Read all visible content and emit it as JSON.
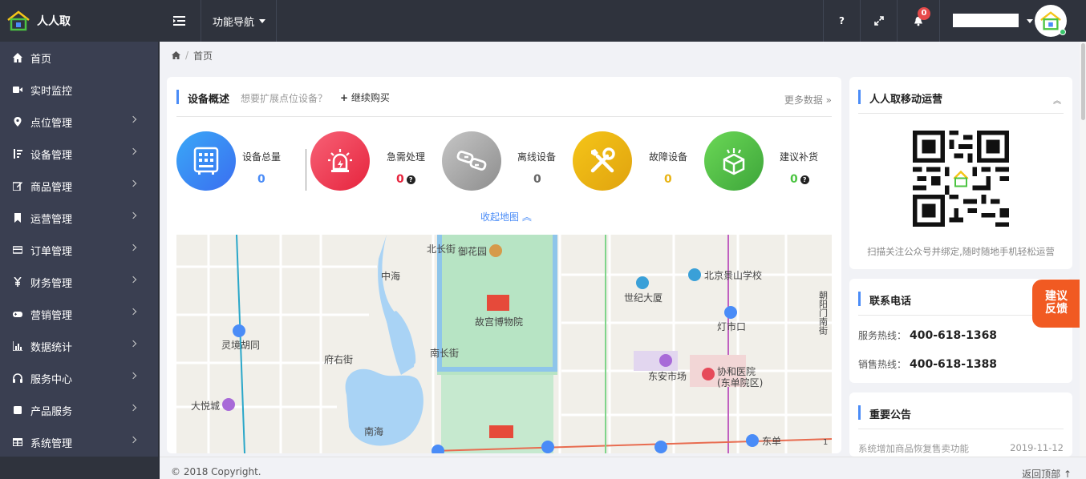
{
  "app": {
    "name": "人人取"
  },
  "topbar": {
    "nav_label": "功能导航",
    "help_label": "?",
    "notification_count": "0"
  },
  "sidebar": {
    "items": [
      {
        "label": "首页",
        "icon": "home-icon"
      },
      {
        "label": "实时监控",
        "icon": "video-icon"
      },
      {
        "label": "点位管理",
        "icon": "map-marker-icon"
      },
      {
        "label": "设备管理",
        "icon": "sort-icon"
      },
      {
        "label": "商品管理",
        "icon": "edit-icon"
      },
      {
        "label": "运营管理",
        "icon": "bookmark-icon"
      },
      {
        "label": "订单管理",
        "icon": "credit-card-icon"
      },
      {
        "label": "财务管理",
        "icon": "yen-icon"
      },
      {
        "label": "营销管理",
        "icon": "gamepad-icon"
      },
      {
        "label": "数据统计",
        "icon": "bar-chart-icon"
      },
      {
        "label": "服务中心",
        "icon": "headphones-icon"
      },
      {
        "label": "产品服务",
        "icon": "square-icon"
      },
      {
        "label": "系统管理",
        "icon": "table-icon"
      }
    ]
  },
  "breadcrumb": {
    "current": "首页"
  },
  "overview": {
    "title": "设备概述",
    "subtitle": "想要扩展点位设备？",
    "buy_label": "继续购买",
    "more_label": "更多数据",
    "collapse_label": "收起地图",
    "stats": [
      {
        "label": "设备总量",
        "value": "0",
        "color": "#4a8cf7",
        "help": false
      },
      {
        "label": "急需处理",
        "value": "0",
        "color": "#e6243d",
        "help": true
      },
      {
        "label": "离线设备",
        "value": "0",
        "color": "#666666",
        "help": false
      },
      {
        "label": "故障设备",
        "value": "0",
        "color": "#e8b415",
        "help": false
      },
      {
        "label": "建议补货",
        "value": "0",
        "color": "#4cc442",
        "help": true
      }
    ]
  },
  "map": {
    "labels": {
      "beichangjie": "北长街",
      "yuhuayuan": "御花园",
      "zhonghai": "中海",
      "gugong": "故宫博物院",
      "jingshan": "北京景山学校",
      "shijidasha": "世纪大厦",
      "dengshikou": "灯市口",
      "chaoyang": "朝阳门南街",
      "linjing": "灵境胡同",
      "fuyoujie": "府右街",
      "nanchangjie": "南长街",
      "dongan": "东安市场",
      "xiehe1": "协和医院",
      "xiehe2": "(东单院区)",
      "dayuecheng": "大悦城",
      "nanhai": "南海",
      "dongdan": "东单",
      "road_tag": "1"
    }
  },
  "mobile": {
    "title": "人人取移动运营",
    "caption": "扫描关注公众号并绑定,随时随地手机轻松运营"
  },
  "contact": {
    "title": "联系电话",
    "service_label": "服务热线：",
    "service_phone": "400-618-1368",
    "sales_label": "销售热线：",
    "sales_phone": "400-618-1388"
  },
  "notice": {
    "title": "重要公告",
    "items": [
      {
        "text": "系统增加商品恢复售卖功能",
        "date": "2019-11-12"
      }
    ]
  },
  "feedback": {
    "line1": "建议",
    "line2": "反馈"
  },
  "footer": {
    "copyright": "© 2018 Copyright.",
    "back_top": "返回顶部"
  }
}
